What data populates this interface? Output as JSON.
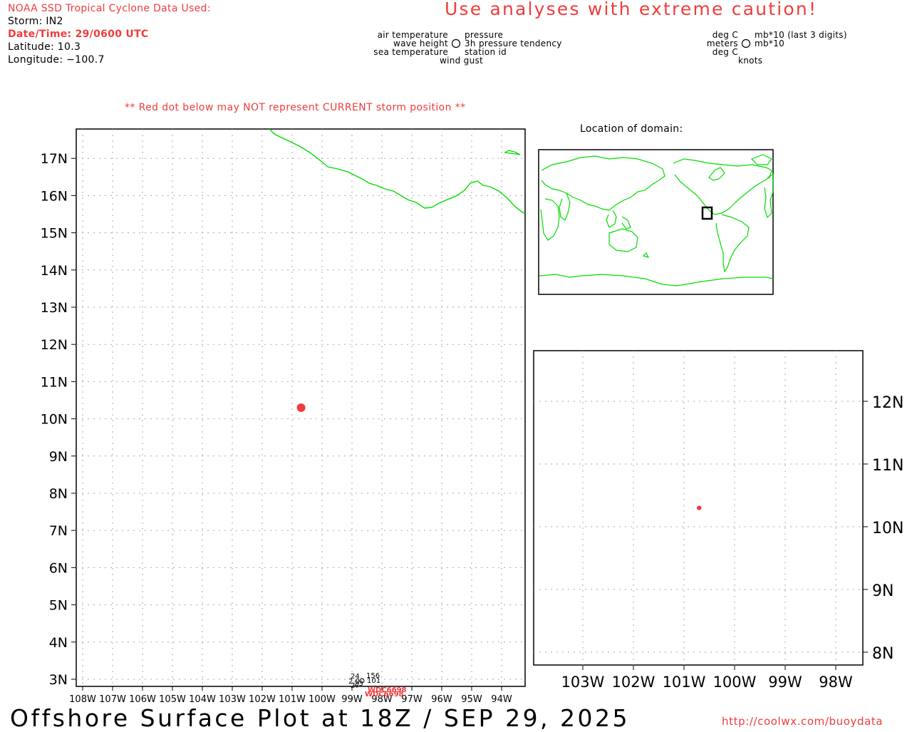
{
  "header": {
    "source": "NOAA SSD Tropical Cyclone Data Used:",
    "storm": "Storm: IN2",
    "datetime": "Date/Time: 29/0600 UTC",
    "latitude": "Latitude: 10.3",
    "longitude": "Longitude: −100.7",
    "caution": "Use analyses with extreme caution!"
  },
  "legend": {
    "air_temperature": "air temperature",
    "wave_height": "wave height",
    "sea_temperature": "sea temperature",
    "wind_gust": "wind gust",
    "pressure": "pressure",
    "pressure_tendency": "3h pressure tendency",
    "station_id": "station id",
    "unit_air": "deg C",
    "unit_wave": "meters",
    "unit_sea": "deg C",
    "unit_gust": "knots",
    "unit_pressure": "mb*10 (last 3 digits)",
    "unit_tendency": "mb*10"
  },
  "warning": "** Red dot below may NOT represent CURRENT storm position **",
  "inset_title": "Location of domain:",
  "main_map": {
    "lat_labels": [
      "17N",
      "16N",
      "15N",
      "14N",
      "13N",
      "12N",
      "11N",
      "10N",
      "9N",
      "8N",
      "7N",
      "6N",
      "5N",
      "4N",
      "3N"
    ],
    "lon_labels": [
      "108W",
      "107W",
      "106W",
      "105W",
      "104W",
      "103W",
      "102W",
      "101W",
      "100W",
      "99W",
      "98W",
      "97W",
      "96W",
      "95W",
      "94W"
    ],
    "storm_position": {
      "lat": 10.3,
      "lon": -100.7
    },
    "coast_color": "#00dd00",
    "storm_color": "#f03c3c",
    "station_plot": {
      "pressure": "156",
      "air_temp": "24",
      "wave": "2.0",
      "sea_temp": "27",
      "tendency": "101",
      "gust": "23",
      "id_1": "WDC6698",
      "id_2": "WDC6698"
    }
  },
  "zoom_map": {
    "lat_labels": [
      "12N",
      "11N",
      "10N",
      "9N",
      "8N"
    ],
    "lon_labels": [
      "103W",
      "102W",
      "101W",
      "100W",
      "99W",
      "98W"
    ]
  },
  "footer": {
    "title": "Offshore Surface Plot at 18Z / SEP 29, 2025",
    "url": "http://coolwx.com/buoydata"
  }
}
